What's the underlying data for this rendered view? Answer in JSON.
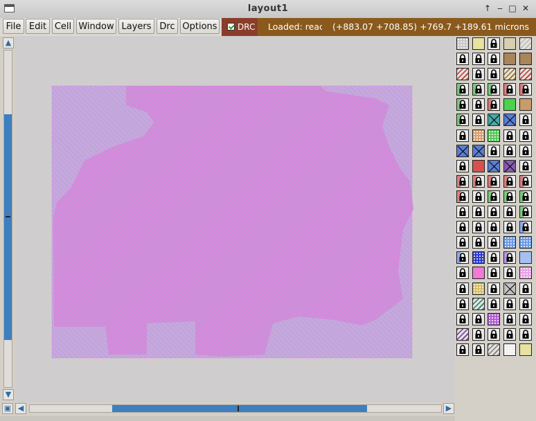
{
  "window": {
    "title": "layout1"
  },
  "menu": {
    "items": [
      "File",
      "Edit",
      "Cell",
      "Window",
      "Layers",
      "Drc",
      "Options"
    ],
    "drc_toggle": {
      "label": "DRC",
      "checked": true
    },
    "status_loaded": "Loaded: reac",
    "status_coords": "(+883.07 +708.85) +769.7 +189.61 microns"
  },
  "scrollbars": {
    "vertical_thumb_fraction": [
      0.19,
      0.86
    ],
    "horizontal_thumb_fraction": [
      0.2,
      0.82
    ]
  },
  "palette": {
    "rows": [
      [
        "dots-gray",
        "yellow-plain",
        "lock",
        "beige-plain",
        "diagonal-gray"
      ],
      [
        "lock",
        "lock",
        "lock",
        "brown-plain",
        "brown-plain"
      ],
      [
        "red-diagonal",
        "lock",
        "lock",
        "brown-hatch",
        "red-hatch"
      ],
      [
        "lock-green",
        "lock-green",
        "lock-green",
        "lock-red",
        "lock-red"
      ],
      [
        "lock-green",
        "lock",
        "lock-red",
        "green-plain",
        "tan-plain"
      ],
      [
        "lock-green",
        "lock",
        "cyan-x",
        "blue-x",
        "lock"
      ],
      [
        "lock",
        "tan-dots",
        "green-dots",
        "lock",
        "lock"
      ],
      [
        "blue-x",
        "blue-x",
        "lock",
        "lock",
        "lock"
      ],
      [
        "lock",
        "red-plain",
        "blue-x",
        "purple-x",
        "lock"
      ],
      [
        "lock-red",
        "lock-red",
        "lock-red",
        "lock-red",
        "lock-red"
      ],
      [
        "lock-red",
        "lock",
        "lock-green",
        "lock-green",
        "lock-green"
      ],
      [
        "lock",
        "lock",
        "lock",
        "lock",
        "lock-green"
      ],
      [
        "lock",
        "lock",
        "lock",
        "lock",
        "lock-blue"
      ],
      [
        "lock",
        "lock",
        "lock",
        "blue-wave",
        "blue-wave"
      ],
      [
        "lock-blue",
        "blue-check",
        "lock",
        "lock-purple",
        "light-blue"
      ],
      [
        "lock",
        "pink-plain",
        "lock",
        "lock",
        "pink-dots"
      ],
      [
        "lock",
        "yellow-dots",
        "lock",
        "gray-x",
        "lock"
      ],
      [
        "lock",
        "teal-diagonal",
        "lock",
        "lock",
        "lock"
      ],
      [
        "lock",
        "lock",
        "purple-dots",
        "lock",
        "lock"
      ],
      [
        "purple-diagonal",
        "lock",
        "lock",
        "lock",
        "lock"
      ],
      [
        "lock",
        "lock",
        "black-diagonal",
        "white-dots",
        "yellow-plain"
      ]
    ],
    "colors": {
      "plain": "#d4d0c8",
      "lock": "#e6e6e6",
      "lock-green": "#7ec77e",
      "lock-red": "#d98080",
      "lock-blue": "#8fa9e8",
      "lock-purple": "#b497e0",
      "dots-gray": "#c8c8c8",
      "yellow-plain": "#e8e2a0",
      "beige-plain": "#d8cfb0",
      "diagonal-gray": "#bdbdbd",
      "brown-plain": "#a8855a",
      "red-diagonal": "#c44a4a",
      "brown-hatch": "#a0783c",
      "red-hatch": "#b84a4a",
      "green-plain": "#4cd24c",
      "tan-plain": "#c89c6a",
      "cyan-x": "#4aa8a8",
      "blue-x": "#5a7ed2",
      "tan-dots": "#d6a070",
      "green-dots": "#5ac85a",
      "red-plain": "#d65050",
      "purple-x": "#8a5ab0",
      "blue-wave": "#6a9ae6",
      "blue-check": "#2a3ad0",
      "light-blue": "#a8c0f0",
      "pink-plain": "#f07ad6",
      "pink-dots": "#e8a0e8",
      "yellow-dots": "#d6c060",
      "gray-x": "#c0c0c0",
      "teal-diagonal": "#3a8a7a",
      "purple-dots": "#b060d0",
      "purple-diagonal": "#7a4ab0",
      "black-diagonal": "#888888",
      "white-dots": "#f0f0f0"
    }
  }
}
